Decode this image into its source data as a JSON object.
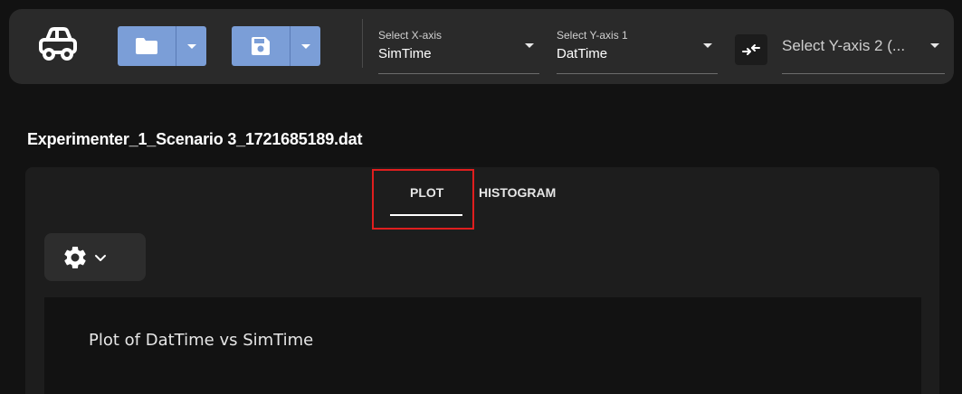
{
  "toolbar": {
    "logo_icon": "car-icon",
    "open_button": {
      "icon": "folder-icon",
      "menu_icon": "chevron-down-icon"
    },
    "save_button": {
      "icon": "floppy-disk-icon",
      "menu_icon": "chevron-down-icon"
    },
    "x_axis": {
      "label": "Select X-axis",
      "value": "SimTime"
    },
    "y_axis_1": {
      "label": "Select Y-axis 1",
      "value": "DatTime"
    },
    "swap_icon": "swap-arrows-icon",
    "y_axis_2": {
      "placeholder": "Select Y-axis 2 (..."
    }
  },
  "file": {
    "name": "Experimenter_1_Scenario 3_1721685189.dat"
  },
  "tabs": [
    {
      "label": "PLOT",
      "selected": true
    },
    {
      "label": "HISTOGRAM",
      "selected": false
    }
  ],
  "settings": {
    "icon": "gear-icon",
    "menu_icon": "chevron-down-icon"
  },
  "plot": {
    "title": "Plot of DatTime vs SimTime"
  },
  "colors": {
    "background": "#121212",
    "toolbar": "#2a2a2a",
    "button": "#7b9ed7",
    "highlight": "#e01e1e"
  }
}
